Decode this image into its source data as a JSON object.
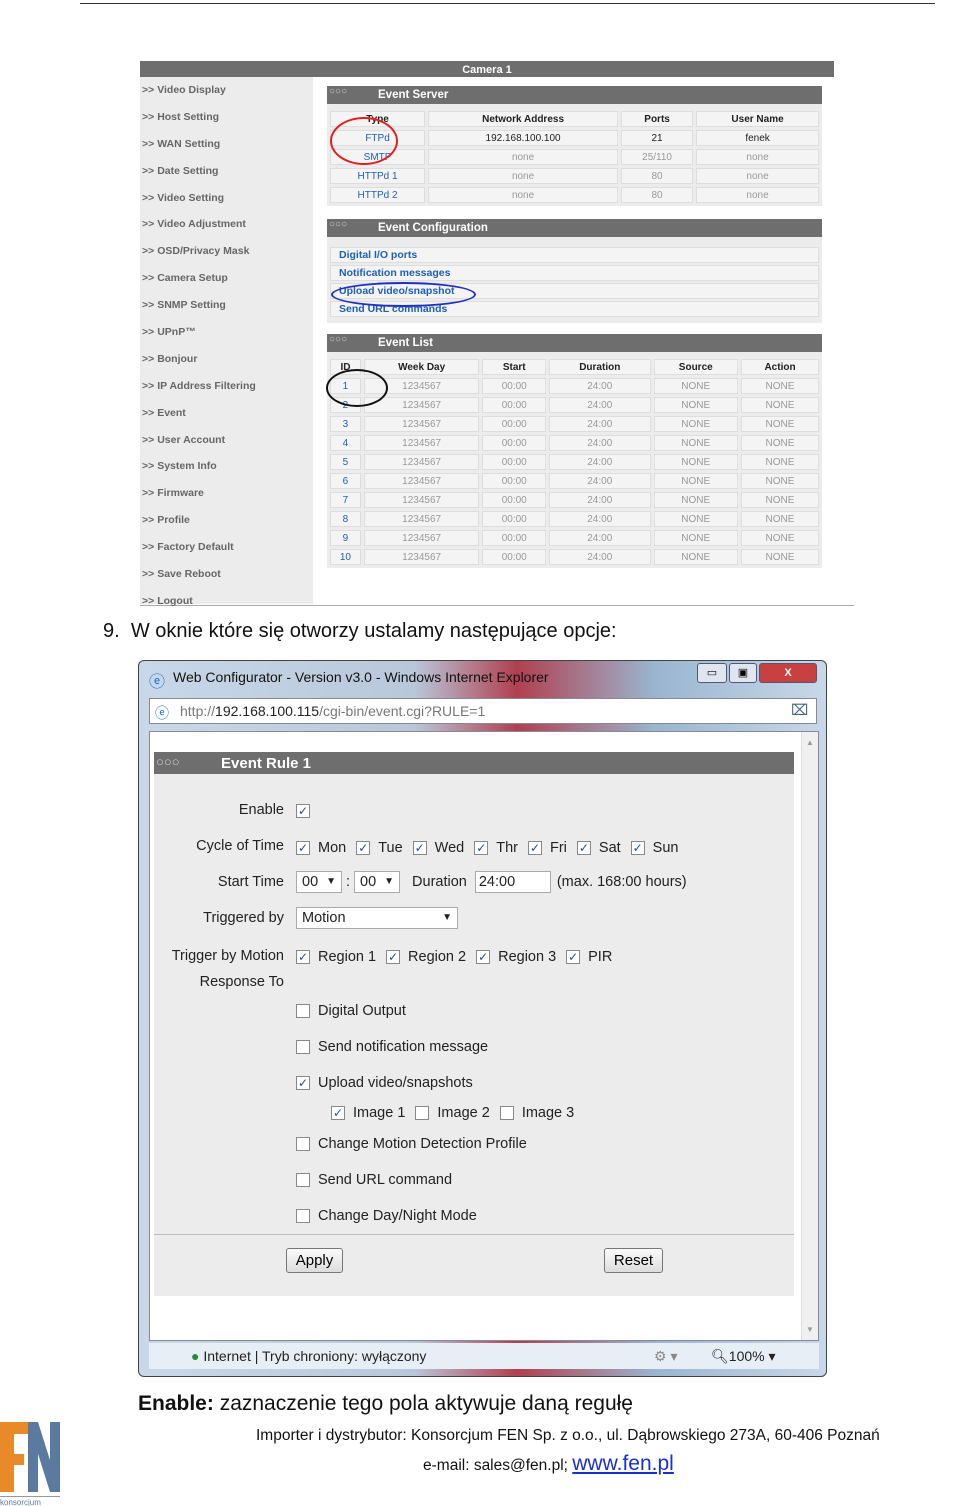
{
  "top_screenshot": {
    "camera_title": "Camera 1",
    "sidebar": [
      "Video Display",
      "Host Setting",
      "WAN Setting",
      "Date Setting",
      "Video Setting",
      "Video Adjustment",
      "OSD/Privacy Mask",
      "Camera Setup",
      "SNMP Setting",
      "UPnP™",
      "Bonjour",
      "IP Address Filtering",
      "Event",
      "User Account",
      "System Info",
      "Firmware",
      "Profile",
      "Factory Default",
      "Save Reboot",
      "Logout"
    ],
    "sidebar_prefix": ">>",
    "event_server": {
      "title": "Event Server",
      "headers": [
        "Type",
        "Network Address",
        "Ports",
        "User Name"
      ],
      "rows": [
        [
          "FTPd",
          "192.168.100.100",
          "21",
          "fenek"
        ],
        [
          "SMTP",
          "none",
          "25/110",
          "none"
        ],
        [
          "HTTPd 1",
          "none",
          "80",
          "none"
        ],
        [
          "HTTPd 2",
          "none",
          "80",
          "none"
        ]
      ]
    },
    "event_configuration": {
      "title": "Event Configuration",
      "links": [
        "Digital I/O ports",
        "Notification messages",
        "Upload video/snapshot",
        "Send URL commands"
      ]
    },
    "event_list": {
      "title": "Event List",
      "headers": [
        "ID",
        "Week Day",
        "Start",
        "Duration",
        "Source",
        "Action"
      ],
      "rows": [
        [
          "1",
          "1234567",
          "00:00",
          "24:00",
          "NONE",
          "NONE"
        ],
        [
          "2",
          "1234567",
          "00:00",
          "24:00",
          "NONE",
          "NONE"
        ],
        [
          "3",
          "1234567",
          "00:00",
          "24:00",
          "NONE",
          "NONE"
        ],
        [
          "4",
          "1234567",
          "00:00",
          "24:00",
          "NONE",
          "NONE"
        ],
        [
          "5",
          "1234567",
          "00:00",
          "24:00",
          "NONE",
          "NONE"
        ],
        [
          "6",
          "1234567",
          "00:00",
          "24:00",
          "NONE",
          "NONE"
        ],
        [
          "7",
          "1234567",
          "00:00",
          "24:00",
          "NONE",
          "NONE"
        ],
        [
          "8",
          "1234567",
          "00:00",
          "24:00",
          "NONE",
          "NONE"
        ],
        [
          "9",
          "1234567",
          "00:00",
          "24:00",
          "NONE",
          "NONE"
        ],
        [
          "10",
          "1234567",
          "00:00",
          "24:00",
          "NONE",
          "NONE"
        ]
      ]
    },
    "annotation_colors": {
      "red": "#e02020",
      "blue": "#2030c0"
    }
  },
  "step": {
    "number": "9.",
    "text": "W oknie które się otworzy ustalamy następujące opcje:"
  },
  "browser": {
    "title": "Web Configurator - Version v3.0 - Windows Internet Explorer",
    "url_prefix": "http://",
    "url_host": "192.168.100.115",
    "url_path": "/cgi-bin/event.cgi?RULE=1",
    "status": "Internet | Tryb chroniony: wyłączony",
    "zoom": "100%"
  },
  "rule": {
    "title": "Event Rule 1",
    "enable_label": "Enable",
    "enable": true,
    "cycle_label": "Cycle of Time",
    "days": [
      {
        "label": "Mon",
        "checked": true
      },
      {
        "label": "Tue",
        "checked": true
      },
      {
        "label": "Wed",
        "checked": true
      },
      {
        "label": "Thr",
        "checked": true
      },
      {
        "label": "Fri",
        "checked": true
      },
      {
        "label": "Sat",
        "checked": true
      },
      {
        "label": "Sun",
        "checked": true
      }
    ],
    "start_label": "Start Time",
    "start_hour": "00",
    "start_sep": ":",
    "start_min": "00",
    "duration_label": "Duration",
    "duration": "24:00",
    "duration_note": "(max. 168:00 hours)",
    "triggered_label": "Triggered by",
    "triggered": "Motion",
    "trigger_motion_label": "Trigger by Motion",
    "regions": [
      {
        "label": "Region 1",
        "checked": true
      },
      {
        "label": "Region 2",
        "checked": true
      },
      {
        "label": "Region 3",
        "checked": true
      },
      {
        "label": "PIR",
        "checked": true
      }
    ],
    "response_label": "Response To",
    "responses": [
      {
        "label": "Digital Output",
        "checked": false
      },
      {
        "label": "Send notification message",
        "checked": false
      },
      {
        "label": "Upload video/snapshots",
        "checked": true
      }
    ],
    "images": [
      {
        "label": "Image 1",
        "checked": true
      },
      {
        "label": "Image 2",
        "checked": false
      },
      {
        "label": "Image 3",
        "checked": false
      }
    ],
    "responses2": [
      {
        "label": "Change Motion Detection Profile",
        "checked": false
      },
      {
        "label": "Send URL command",
        "checked": false
      },
      {
        "label": "Change Day/Night Mode",
        "checked": false
      }
    ],
    "apply": "Apply",
    "reset": "Reset"
  },
  "caption": {
    "bold": "Enable:",
    "text": " zaznaczenie tego pola aktywuje daną regułę"
  },
  "footer": {
    "line1": "Importer i dystrybutor: Konsorcjum FEN Sp. z o.o., ul. Dąbrowskiego 273A, 60-406 Poznań",
    "email": "e-mail: sales@fen.pl; ",
    "website": "www.fen.pl",
    "logo_text": "FEN",
    "logo_sub": "konsorcjum",
    "logo_colors": {
      "orange": "#e8892a",
      "blue": "#5a7aa0"
    }
  }
}
